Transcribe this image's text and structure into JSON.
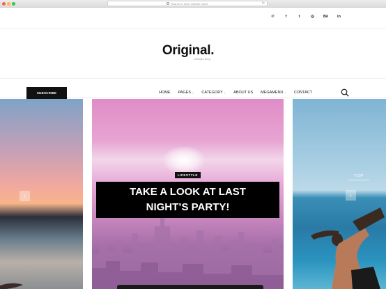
{
  "browser": {
    "url_placeholder": "Search or enter website name",
    "reload_icon": "reload-icon"
  },
  "social": [
    {
      "name": "pinterest-icon",
      "glyph": "℗"
    },
    {
      "name": "facebook-icon",
      "glyph": "f"
    },
    {
      "name": "twitter-icon",
      "glyph": "t"
    },
    {
      "name": "instagram-icon",
      "glyph": "◎"
    },
    {
      "name": "behance-icon",
      "glyph": "Bē"
    },
    {
      "name": "linkedin-icon",
      "glyph": "in"
    }
  ],
  "header": {
    "logo": "Original.",
    "tagline": "Lifestyle Blog"
  },
  "nav": {
    "subscribe_label": "SUBSCRIBE",
    "items": [
      {
        "label": "HOME",
        "dropdown": false
      },
      {
        "label": "PAGES",
        "dropdown": true
      },
      {
        "label": "CATEGORY",
        "dropdown": true
      },
      {
        "label": "ABOUT US",
        "dropdown": false
      },
      {
        "label": "MEGAMENU",
        "dropdown": true
      },
      {
        "label": "CONTACT",
        "dropdown": false
      }
    ],
    "search_icon": "search-icon"
  },
  "slider": {
    "badge": "LIFESTYLE",
    "headline_line1": "TAKE A LOOK AT LAST",
    "headline_line2": "NIGHT’S PARTY!",
    "prev_label": "‹",
    "next_label": "›",
    "top_label": "TOP"
  }
}
